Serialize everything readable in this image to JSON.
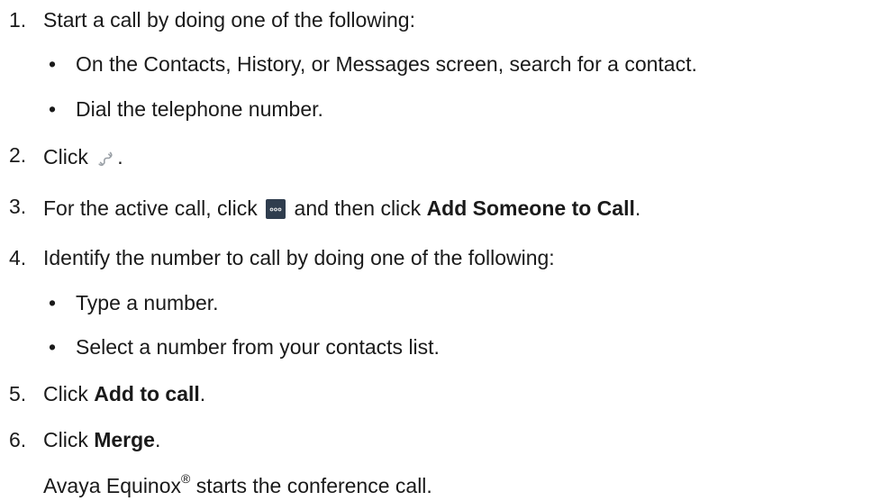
{
  "steps": [
    {
      "number": "1.",
      "text": "Start a call by doing one of the following:",
      "bullets": [
        "On the Contacts, History, or Messages screen, search for a contact.",
        "Dial the telephone number."
      ]
    },
    {
      "number": "2.",
      "before": "Click",
      "icon": "phone-handset-icon",
      "after": "."
    },
    {
      "number": "3.",
      "before": "For the active call, click",
      "icon": "more-options-icon",
      "middle": "and then click",
      "bold": "Add Someone to Call",
      "after": "."
    },
    {
      "number": "4.",
      "text": "Identify the number to call by doing one of the following:",
      "bullets": [
        "Type a number.",
        "Select a number from your contacts list."
      ]
    },
    {
      "number": "5.",
      "before": "Click",
      "bold": "Add to call",
      "after": "."
    },
    {
      "number": "6.",
      "before": "Click",
      "bold": "Merge",
      "after": "."
    }
  ],
  "result": {
    "product": "Avaya Equinox",
    "trademark": "®",
    "text": "starts the conference call."
  },
  "bullet_char": "•"
}
